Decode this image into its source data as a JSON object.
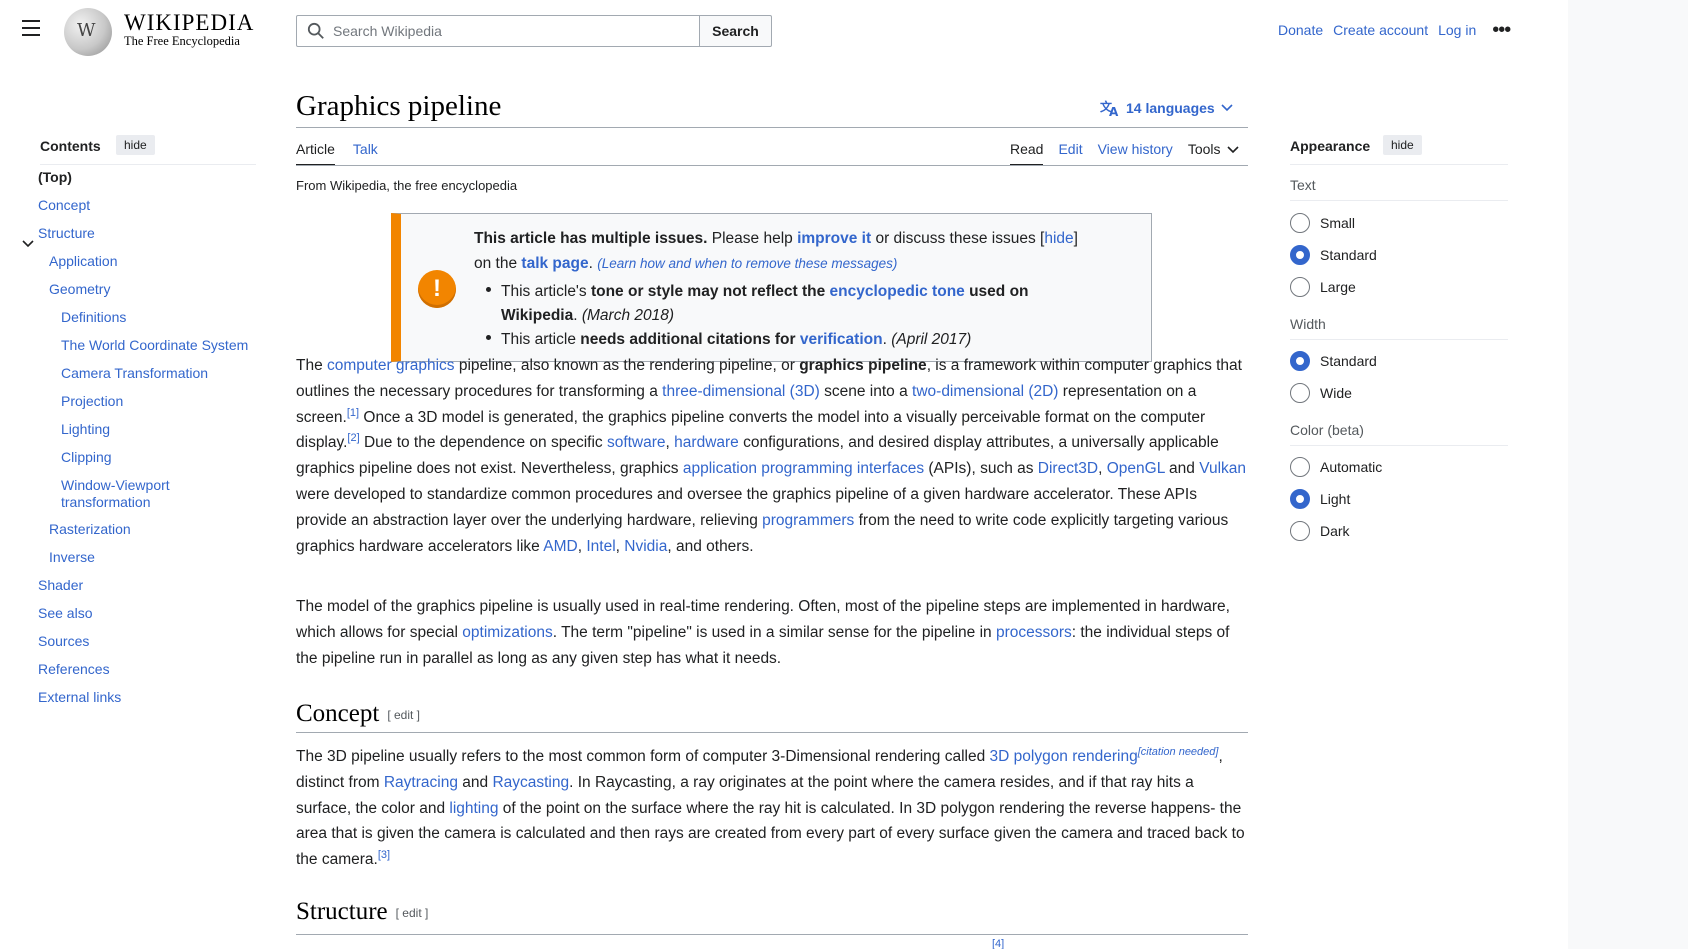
{
  "header": {
    "wordmark": "WIKIPEDIA",
    "tagline": "The Free Encyclopedia",
    "search_placeholder": "Search Wikipedia",
    "search_button": "Search",
    "donate": "Donate",
    "create_account": "Create account",
    "log_in": "Log in",
    "more": "•••"
  },
  "toc": {
    "title": "Contents",
    "hide": "hide",
    "items": [
      {
        "label": "(Top)"
      },
      {
        "label": "Concept"
      },
      {
        "label": "Structure"
      },
      {
        "label": "Application"
      },
      {
        "label": "Geometry"
      },
      {
        "label": "Definitions"
      },
      {
        "label": "The World Coordinate System"
      },
      {
        "label": "Camera Transformation"
      },
      {
        "label": "Projection"
      },
      {
        "label": "Lighting"
      },
      {
        "label": "Clipping"
      },
      {
        "label": "Window-Viewport transformation"
      },
      {
        "label": "Rasterization"
      },
      {
        "label": "Inverse"
      },
      {
        "label": "Shader"
      },
      {
        "label": "See also"
      },
      {
        "label": "Sources"
      },
      {
        "label": "References"
      },
      {
        "label": "External links"
      }
    ]
  },
  "article": {
    "title": "Graphics pipeline",
    "languages": "14 languages",
    "tabs": {
      "article": "Article",
      "talk": "Talk",
      "read": "Read",
      "edit": "Edit",
      "history": "View history",
      "tools": "Tools"
    },
    "from": "From Wikipedia, the free encyclopedia",
    "ambox": {
      "bold": "This article has multiple issues.",
      "t1": " Please help ",
      "improve": "improve it",
      "t2": " or discuss these issues ",
      "hide": "hide",
      "t3": "on the ",
      "talk": "talk page",
      "t4": ". ",
      "learn": "(Learn how and when to remove these messages)",
      "issue1_a": "This article's ",
      "issue1_b": "tone or style may not reflect the ",
      "issue1_link": "encyclopedic tone",
      "issue1_c": " used on",
      "issue1_d": "Wikipedia",
      "issue1_e": ". ",
      "issue1_date": "(March 2018)",
      "issue2_a": "This article ",
      "issue2_b": "needs additional citations for ",
      "issue2_link": "verification",
      "issue2_c": ". ",
      "issue2_date": "(April 2017)"
    },
    "p1": {
      "a": "The ",
      "l1": "computer graphics",
      "b": " pipeline, also known as the rendering pipeline, or ",
      "bold": "graphics pipeline",
      "c": ", is a framework within computer graphics that outlines the necessary procedures for transforming a ",
      "l2": "three-dimensional (3D)",
      "d": " scene into a ",
      "l3": "two-dimensional (2D)",
      "e": " representation on a screen.",
      "r1": "[1]",
      "f": " Once a 3D model is generated, the graphics pipeline converts the model into a visually perceivable format on the computer display.",
      "r2": "[2]",
      "g": " Due to the dependence on specific ",
      "l4": "software",
      "h": ", ",
      "l5": "hardware",
      "i": " configurations, and desired display attributes, a universally applicable graphics pipeline does not exist. Nevertheless, graphics ",
      "l6": "application programming interfaces",
      "j": " (APIs), such as ",
      "l7": "Direct3D",
      "k": ", ",
      "l8": "OpenGL",
      "m": " and ",
      "l9": "Vulkan",
      "n": " were developed to standardize common procedures and oversee the graphics pipeline of a given hardware accelerator. These APIs provide an abstraction layer over the underlying hardware, relieving ",
      "l10": "programmers",
      "o": " from the need to write code explicitly targeting various graphics hardware accelerators like ",
      "l11": "AMD",
      "p": ", ",
      "l12": "Intel",
      "q": ", ",
      "l13": "Nvidia",
      "r": ", and others."
    },
    "p2": {
      "a": "The model of the graphics pipeline is usually used in real-time rendering. Often, most of the pipeline steps are implemented in hardware, which allows for special ",
      "l1": "optimizations",
      "b": ". The term \"pipeline\" is used in a similar sense for the pipeline in ",
      "l2": "processors",
      "c": ": the individual steps of the pipeline run in parallel as long as any given step has what it needs."
    },
    "h_concept": "Concept",
    "h_structure": "Structure",
    "edit_label": "[ edit ]",
    "p3": {
      "a": "The 3D pipeline usually refers to the most common form of computer 3-Dimensional rendering called ",
      "l1": "3D polygon rendering",
      "cn": "[citation needed]",
      "b": ", distinct from ",
      "l2": "Raytracing",
      "c": " and ",
      "l3": "Raycasting",
      "d": ". In Raycasting, a ray originates at the point where the camera resides, and if that ray hits a surface, the color and ",
      "l4": "lighting",
      "e": " of the point on the surface where the ray hit is calculated. In 3D polygon rendering the reverse happens- the area that is given the camera is calculated and then rays are created from every part of every surface given the camera and traced back to the camera.",
      "r3": "[3]"
    },
    "bottom_ref": "[4]"
  },
  "appearance": {
    "title": "Appearance",
    "hide": "hide",
    "text_label": "Text",
    "text_options": [
      "Small",
      "Standard",
      "Large"
    ],
    "text_selected": "Standard",
    "width_label": "Width",
    "width_options": [
      "Standard",
      "Wide"
    ],
    "width_selected": "Standard",
    "color_label": "Color (beta)",
    "color_options": [
      "Automatic",
      "Light",
      "Dark"
    ],
    "color_selected": "Light"
  },
  "colors": {
    "link": "#3366cc",
    "ambox_accent": "#f28500",
    "text": "#202122"
  }
}
